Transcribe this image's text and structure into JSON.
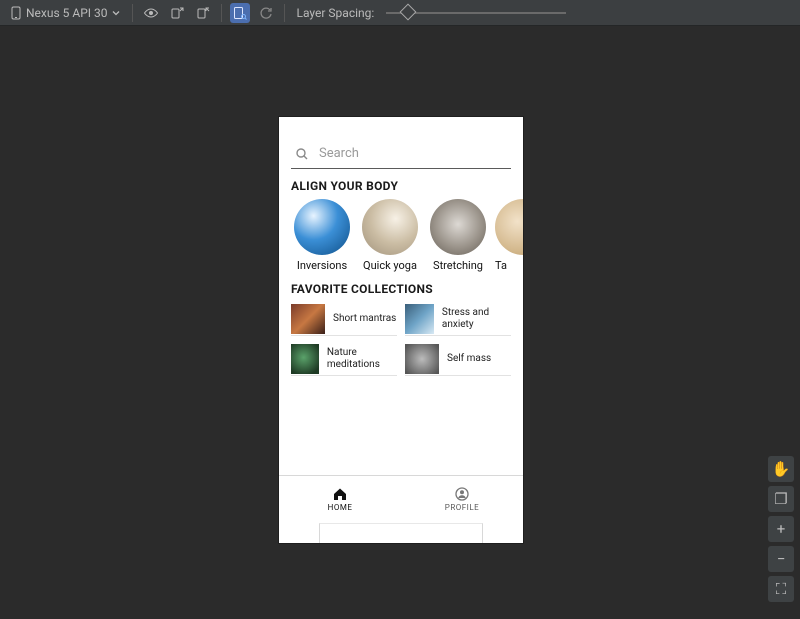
{
  "toolbar": {
    "device_name": "Nexus 5 API 30",
    "layer_spacing_label": "Layer Spacing:",
    "slider_value_pct": 12
  },
  "app": {
    "search_placeholder": "Search",
    "section_align_title": "ALIGN YOUR BODY",
    "align_items": [
      {
        "label": "Inversions"
      },
      {
        "label": "Quick yoga"
      },
      {
        "label": "Stretching"
      },
      {
        "label": "Ta"
      }
    ],
    "section_fav_title": "FAVORITE COLLECTIONS",
    "fav_items": [
      {
        "label": "Short mantras"
      },
      {
        "label": "Stress and anxiety"
      },
      {
        "label": "Nature meditations"
      },
      {
        "label": "Self mass"
      }
    ],
    "nav": {
      "home": "HOME",
      "profile": "PROFILE"
    }
  },
  "right_tools": {
    "pan": "✋",
    "layers": "❐",
    "zoom_in": "+",
    "zoom_out": "−",
    "fullscreen": "⛶"
  }
}
